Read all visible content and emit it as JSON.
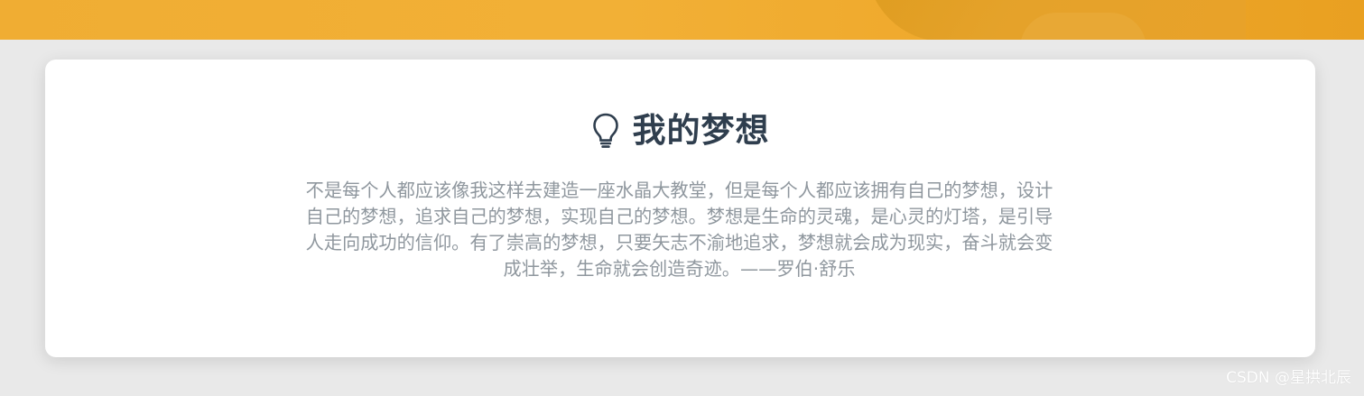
{
  "section": {
    "icon": "lightbulb-icon",
    "title": "我的梦想",
    "paragraph": "不是每个人都应该像我这样去建造一座水晶大教堂，但是每个人都应该拥有自己的梦想，设计自己的梦想，追求自己的梦想，实现自己的梦想。梦想是生命的灵魂，是心灵的灯塔，是引导人走向成功的信仰。有了崇高的梦想，只要矢志不渝地追求，梦想就会成为现实，奋斗就会变成壮举，生命就会创造奇迹。——罗伯·舒乐"
  },
  "watermark": "CSDN @星拱北辰",
  "colors": {
    "title": "#2f3e4e",
    "text": "#8f979e",
    "banner": "#f0ad33",
    "background": "#e9e9e9"
  }
}
